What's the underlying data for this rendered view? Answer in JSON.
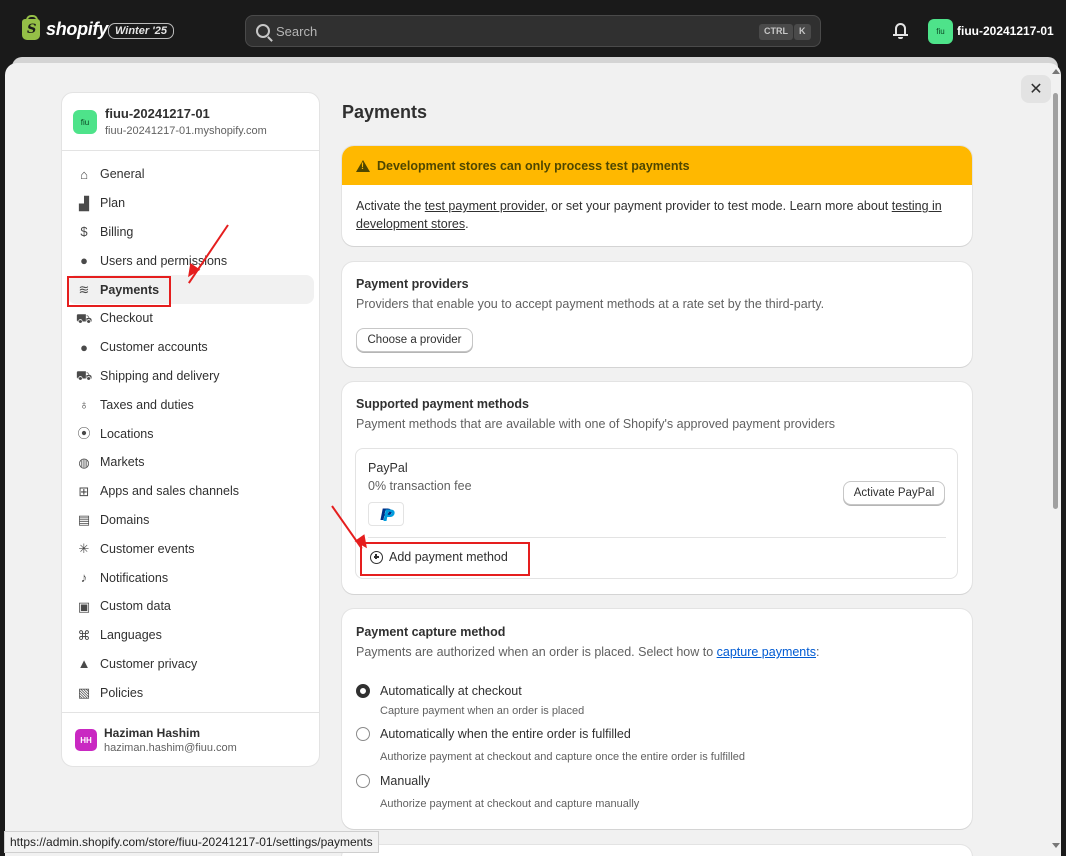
{
  "topbar": {
    "logo_text": "shopify",
    "release_badge": "Winter '25",
    "search_placeholder": "Search",
    "shortcut_keys": [
      "CTRL",
      "K"
    ],
    "store_initials": "fiu",
    "store_name": "fiuu-20241217-01"
  },
  "sidebar": {
    "store_initials": "fiu",
    "store_name": "fiuu-20241217-01",
    "store_url": "fiuu-20241217-01.myshopify.com",
    "items": [
      {
        "label": "General",
        "icon": "store-icon"
      },
      {
        "label": "Plan",
        "icon": "plan-icon"
      },
      {
        "label": "Billing",
        "icon": "billing-icon"
      },
      {
        "label": "Users and permissions",
        "icon": "user-icon"
      },
      {
        "label": "Payments",
        "icon": "payments-icon"
      },
      {
        "label": "Checkout",
        "icon": "cart-icon"
      },
      {
        "label": "Customer accounts",
        "icon": "person-icon"
      },
      {
        "label": "Shipping and delivery",
        "icon": "truck-icon"
      },
      {
        "label": "Taxes and duties",
        "icon": "tax-icon"
      },
      {
        "label": "Locations",
        "icon": "location-icon"
      },
      {
        "label": "Markets",
        "icon": "globe-icon"
      },
      {
        "label": "Apps and sales channels",
        "icon": "apps-icon"
      },
      {
        "label": "Domains",
        "icon": "domain-icon"
      },
      {
        "label": "Customer events",
        "icon": "cursor-icon"
      },
      {
        "label": "Notifications",
        "icon": "bell-icon"
      },
      {
        "label": "Custom data",
        "icon": "data-icon"
      },
      {
        "label": "Languages",
        "icon": "language-icon"
      },
      {
        "label": "Customer privacy",
        "icon": "lock-icon"
      },
      {
        "label": "Policies",
        "icon": "policy-icon"
      }
    ],
    "active_item": "Payments",
    "user": {
      "initials": "HH",
      "name": "Haziman Hashim",
      "email": "haziman.hashim@fiuu.com"
    }
  },
  "main": {
    "title": "Payments",
    "banner": {
      "title": "Development stores can only process test payments",
      "text_1": "Activate the ",
      "link_1": "test payment provider",
      "text_2": ", or set your payment provider to test mode. Learn more about ",
      "link_2": "testing in development stores",
      "text_3": "."
    },
    "providers": {
      "title": "Payment providers",
      "subtitle": "Providers that enable you to accept payment methods at a rate set by the third-party.",
      "button": "Choose a provider"
    },
    "methods": {
      "title": "Supported payment methods",
      "subtitle": "Payment methods that are available with one of Shopify's approved payment providers",
      "paypal_name": "PayPal",
      "paypal_fee": "0% transaction fee",
      "paypal_button": "Activate PayPal",
      "add_method": "Add payment method"
    },
    "capture": {
      "title": "Payment capture method",
      "subtitle_text": "Payments are authorized when an order is placed. Select how to ",
      "subtitle_link": "capture payments",
      "subtitle_end": ":",
      "options": [
        {
          "label": "Automatically at checkout",
          "help": "Capture payment when an order is placed",
          "checked": true
        },
        {
          "label": "Automatically when the entire order is fulfilled",
          "help": "Authorize payment at checkout and capture once the entire order is fulfilled",
          "checked": false
        },
        {
          "label": "Manually",
          "help": "Authorize payment at checkout and capture manually",
          "checked": false
        }
      ]
    }
  },
  "status_url": "https://admin.shopify.com/store/fiuu-20241217-01/settings/payments",
  "colors": {
    "banner_warning": "#ffb800",
    "annotation_red": "#e51e1e",
    "store_avatar": "#4ee38a",
    "user_avatar": "#c928c2",
    "link_blue": "#005bd3"
  }
}
